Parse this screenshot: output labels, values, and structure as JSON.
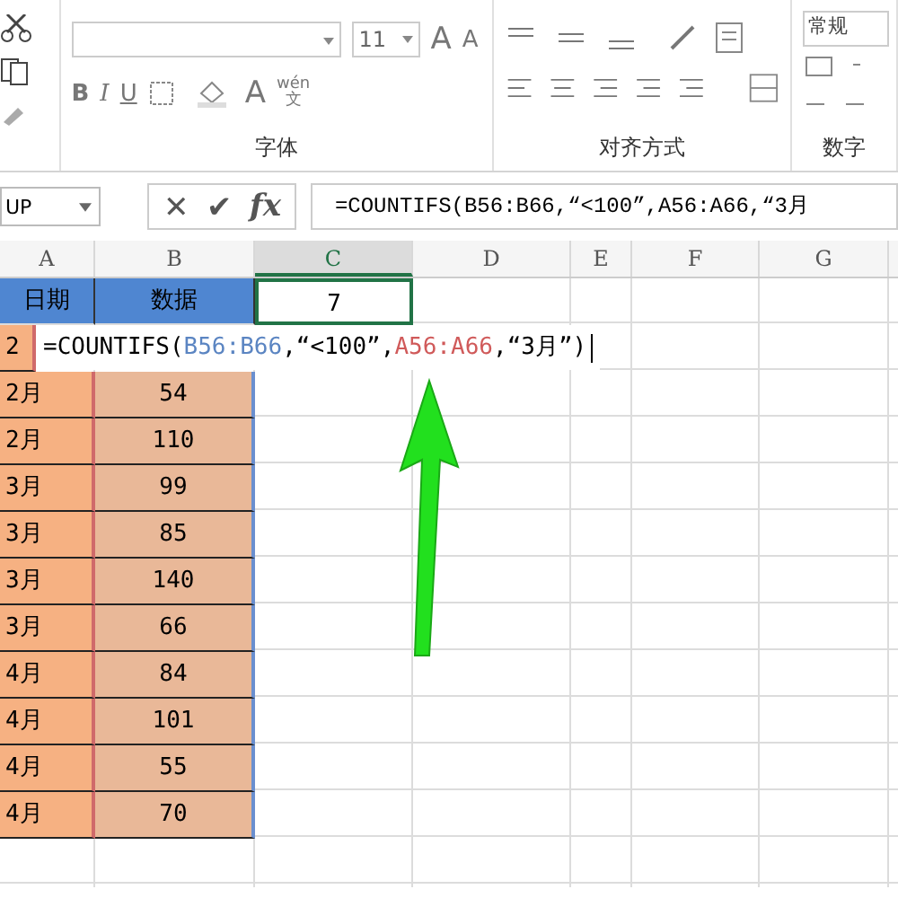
{
  "ribbon": {
    "font_group": {
      "label": "字体",
      "font_size": "11",
      "grow_letter": "A",
      "shrink_letter": "A",
      "bold": "B",
      "italic": "I",
      "underline": "U",
      "font_color_letter": "A",
      "phonetic_top": "wén",
      "phonetic_bottom": "文"
    },
    "alignment_group": {
      "label": "对齐方式"
    },
    "number_group": {
      "label": "数字",
      "format": "常规"
    }
  },
  "formula_bar": {
    "name_box": "UP",
    "cancel": "✕",
    "enter": "✔",
    "fx": "fx",
    "formula": "=COUNTIFS(B56:B66,“<100”,A56:A66,“3月"
  },
  "columns": [
    {
      "label": "A",
      "selected": false
    },
    {
      "label": "B",
      "selected": false
    },
    {
      "label": "C",
      "selected": true
    },
    {
      "label": "D",
      "selected": false
    },
    {
      "label": "E",
      "selected": false
    },
    {
      "label": "F",
      "selected": false
    },
    {
      "label": "G",
      "selected": false
    }
  ],
  "rows": [
    {
      "kind": "header",
      "a": "日期",
      "b": "数据",
      "c": "7"
    },
    {
      "kind": "editing",
      "a": "2"
    },
    {
      "kind": "data",
      "a": "2月",
      "b": "54"
    },
    {
      "kind": "data",
      "a": "2月",
      "b": "110"
    },
    {
      "kind": "data",
      "a": "3月",
      "b": "99"
    },
    {
      "kind": "data",
      "a": "3月",
      "b": "85"
    },
    {
      "kind": "data",
      "a": "3月",
      "b": "140"
    },
    {
      "kind": "data",
      "a": "3月",
      "b": "66"
    },
    {
      "kind": "data",
      "a": "4月",
      "b": "84"
    },
    {
      "kind": "data",
      "a": "4月",
      "b": "101"
    },
    {
      "kind": "data",
      "a": "4月",
      "b": "55"
    },
    {
      "kind": "data",
      "a": "4月",
      "b": "70"
    }
  ],
  "in_cell_edit": [
    {
      "text": "=COUNTIFS("
    },
    {
      "text": "B56:B66",
      "color": "#5b85c2"
    },
    {
      "text": ",“<100”,"
    },
    {
      "text": "A56:A66",
      "color": "#d05a5a"
    },
    {
      "text": ",“3月”)"
    }
  ]
}
